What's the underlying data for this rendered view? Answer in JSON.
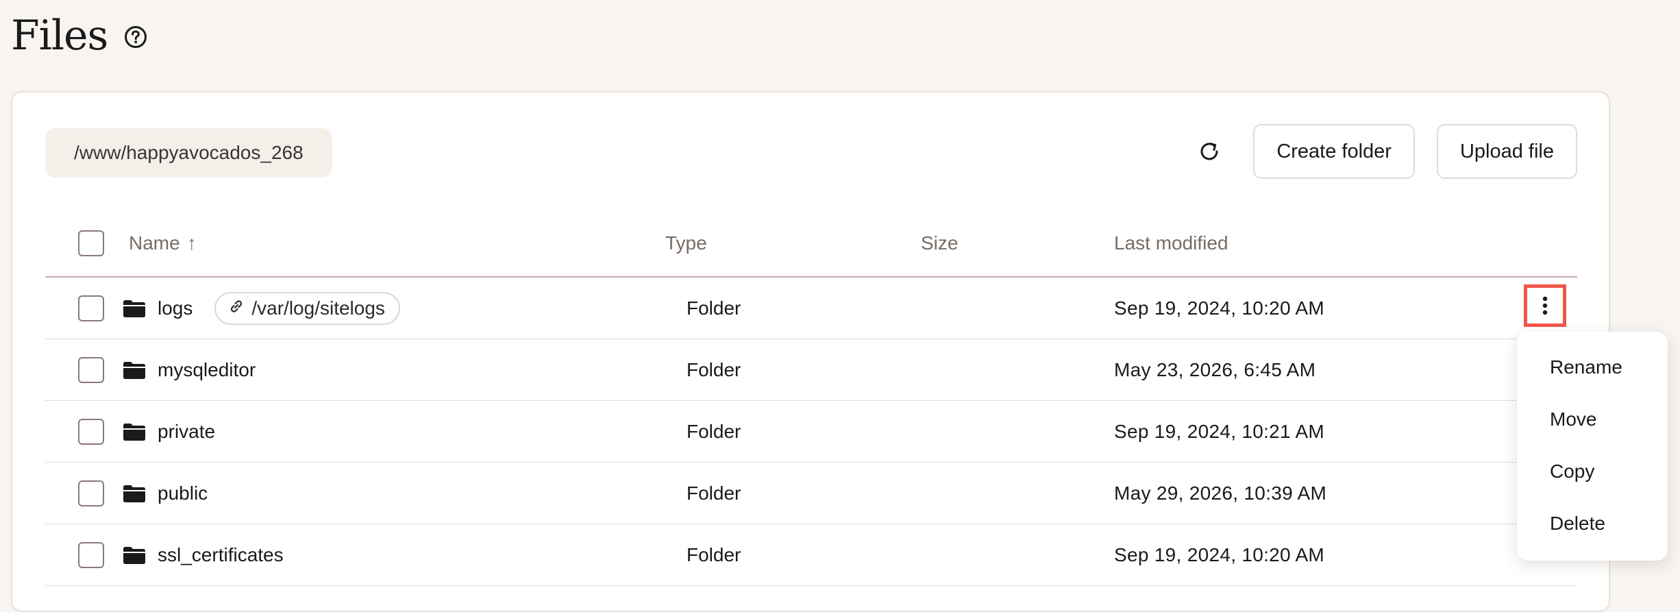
{
  "page": {
    "title": "Files",
    "help_icon": "help-circle-icon"
  },
  "toolbar": {
    "path": "/www/happyavocados_268",
    "refresh_icon": "refresh-icon",
    "create_folder_label": "Create folder",
    "upload_file_label": "Upload file"
  },
  "table": {
    "columns": {
      "name": "Name",
      "name_sort": "↑",
      "type": "Type",
      "size": "Size",
      "last_modified": "Last modified"
    },
    "rows": [
      {
        "name": "logs",
        "symlink": "/var/log/sitelogs",
        "type": "Folder",
        "size": "",
        "modified": "Sep 19, 2024, 10:20 AM"
      },
      {
        "name": "mysqleditor",
        "type": "Folder",
        "size": "",
        "modified": "May 23, 2026, 6:45 AM"
      },
      {
        "name": "private",
        "type": "Folder",
        "size": "",
        "modified": "Sep 19, 2024, 10:21 AM"
      },
      {
        "name": "public",
        "type": "Folder",
        "size": "",
        "modified": "May 29, 2026, 10:39 AM"
      },
      {
        "name": "ssl_certificates",
        "type": "Folder",
        "size": "",
        "modified": "Sep 19, 2024, 10:20 AM"
      }
    ]
  },
  "context_menu": {
    "items": [
      "Rename",
      "Move",
      "Copy",
      "Delete"
    ]
  },
  "colors": {
    "background": "#f7f4f1",
    "highlight": "#f0574a",
    "header_divider": "#c9aaa8"
  }
}
